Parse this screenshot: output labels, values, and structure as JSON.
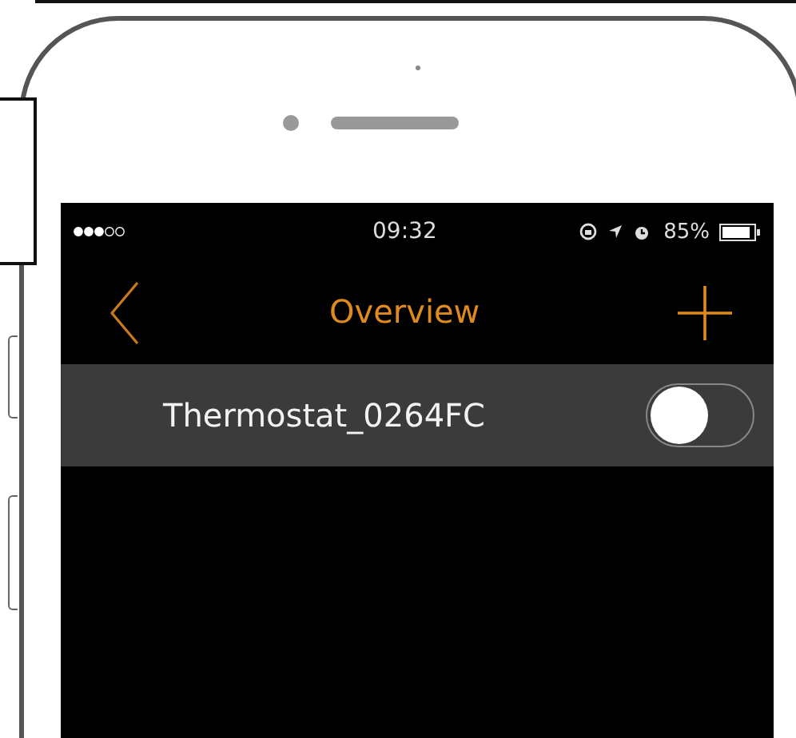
{
  "status_bar": {
    "time": "09:32",
    "battery": "85%"
  },
  "nav": {
    "title": "Overview"
  },
  "devices": [
    {
      "name": "Thermostat_0264FC",
      "on": false
    }
  ]
}
